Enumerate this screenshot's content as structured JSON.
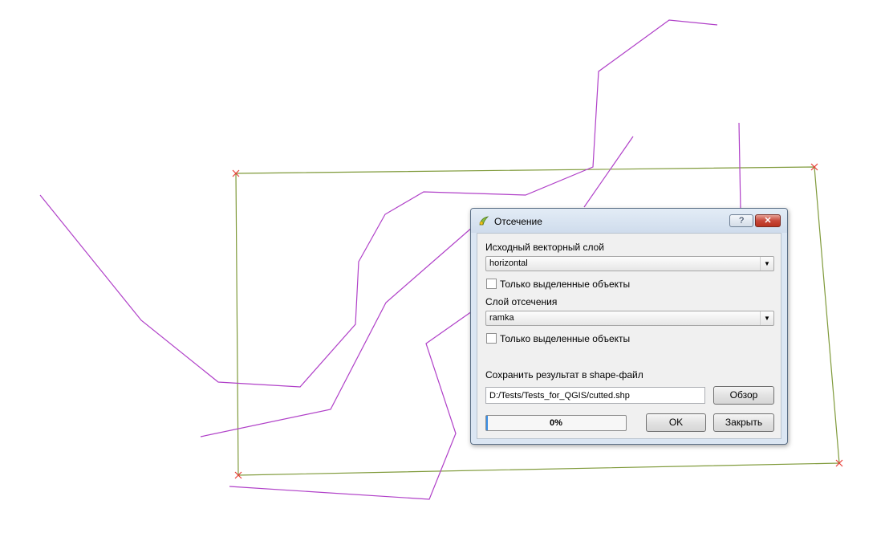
{
  "dialog": {
    "title": "Отсечение",
    "help_label": "?",
    "close_glyph": "✕",
    "input_layer_label": "Исходный векторный слой",
    "input_layer_value": "horizontal",
    "selected_only_1": "Только выделенные объекты",
    "clip_layer_label": "Слой отсечения",
    "clip_layer_value": "ramka",
    "selected_only_2": "Только выделенные объекты",
    "save_label": "Сохранить результат в shape-файл",
    "output_path": "D:/Tests/Tests_for_QGIS/cutted.shp",
    "browse_label": "Обзор",
    "progress": 0,
    "progress_text": "0%",
    "ok_label": "OK",
    "close_label": "Закрыть"
  },
  "icons": {
    "app": "qgis-icon",
    "dropdown": "chevron-down-icon",
    "close": "close-icon",
    "help": "help-icon"
  },
  "colors": {
    "polygon_outline": "#7f9a3a",
    "polyline": "#b040c8",
    "vertex_marker": "#e8403a",
    "progress_fill": "#3a8ee6"
  }
}
